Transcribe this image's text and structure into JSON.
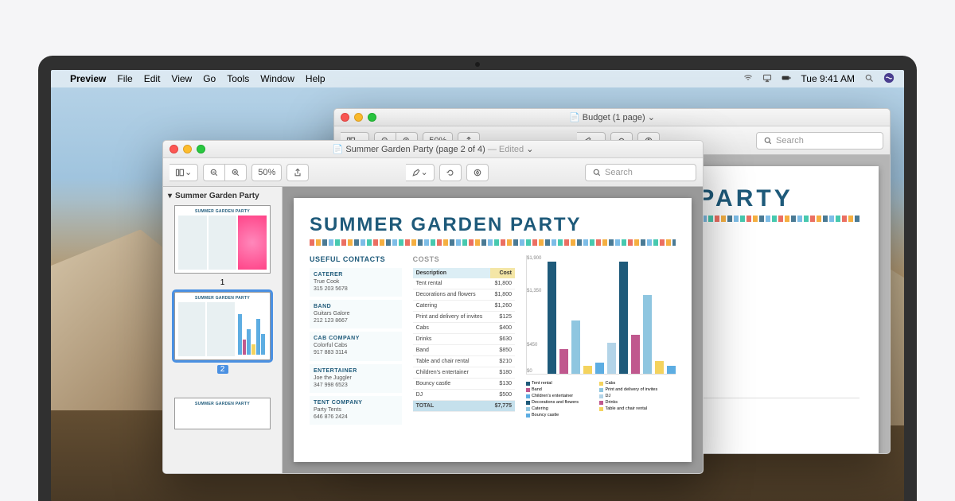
{
  "menubar": {
    "app": "Preview",
    "items": [
      "File",
      "Edit",
      "View",
      "Go",
      "Tools",
      "Window",
      "Help"
    ],
    "time": "Tue 9:41 AM"
  },
  "windows": {
    "back": {
      "title": "Budget (1 page)",
      "title_suffix": "",
      "zoom": "50%",
      "search_placeholder": "Search"
    },
    "front": {
      "title": "Summer Garden Party (page 2 of 4)",
      "title_suffix": "— Edited",
      "zoom": "50%",
      "search_placeholder": "Search",
      "sidebar_title": "Summer Garden Party",
      "thumb_labels": [
        "1",
        "2"
      ]
    }
  },
  "document": {
    "title": "SUMMER GARDEN PARTY",
    "contacts_heading": "USEFUL CONTACTS",
    "costs_heading": "COSTS",
    "contacts": [
      {
        "label": "CATERER",
        "name": "True Cook",
        "phone": "315 203 5678"
      },
      {
        "label": "BAND",
        "name": "Guitars Galore",
        "phone": "212 123 8667"
      },
      {
        "label": "CAB COMPANY",
        "name": "Colorful Cabs",
        "phone": "917 883 3114"
      },
      {
        "label": "ENTERTAINER",
        "name": "Joe the Juggler",
        "phone": "347 998 6523"
      },
      {
        "label": "TENT COMPANY",
        "name": "Party Tents",
        "phone": "646 876 2424"
      }
    ],
    "costs_cols": [
      "Description",
      "Cost"
    ],
    "costs": [
      {
        "d": "Tent rental",
        "c": "$1,800"
      },
      {
        "d": "Decorations and flowers",
        "c": "$1,800"
      },
      {
        "d": "Catering",
        "c": "$1,260"
      },
      {
        "d": "Print and delivery of invites",
        "c": "$125"
      },
      {
        "d": "Cabs",
        "c": "$400"
      },
      {
        "d": "Drinks",
        "c": "$630"
      },
      {
        "d": "Band",
        "c": "$850"
      },
      {
        "d": "Table and chair rental",
        "c": "$210"
      },
      {
        "d": "Children's entertainer",
        "c": "$180"
      },
      {
        "d": "Bouncy castle",
        "c": "$130"
      },
      {
        "d": "DJ",
        "c": "$500"
      }
    ],
    "total_label": "TOTAL",
    "total_value": "$7,775"
  },
  "chart_data": {
    "type": "bar",
    "title": "",
    "xlabel": "",
    "ylabel": "",
    "ylim": [
      0,
      1900
    ],
    "yticks": [
      "$1,900",
      "$1,350",
      "$450",
      "$0"
    ],
    "categories": [
      "Tent rental",
      "Cabs",
      "Band",
      "Print and delivery of invites",
      "Children's entertainer",
      "DJ",
      "Decorations and flowers",
      "Drinks",
      "Catering",
      "Table and chair rental",
      "Bouncy castle"
    ],
    "values": [
      1800,
      400,
      850,
      125,
      180,
      500,
      1800,
      630,
      1260,
      210,
      130
    ],
    "colors": [
      "#1e5a7a",
      "#c0588e",
      "#8fc6e0",
      "#f4d35e",
      "#5dade2",
      "#b3d4e8",
      "#1e5a7a",
      "#c0588e",
      "#8fc6e0",
      "#f4d35e",
      "#5dade2"
    ],
    "legend": [
      {
        "name": "Tent rental",
        "color": "#1e5a7a"
      },
      {
        "name": "Cabs",
        "color": "#f4d35e"
      },
      {
        "name": "Band",
        "color": "#c0588e"
      },
      {
        "name": "Print and delivery of invites",
        "color": "#8fc6e0"
      },
      {
        "name": "Children's entertainer",
        "color": "#5dade2"
      },
      {
        "name": "DJ",
        "color": "#b3d4e8"
      },
      {
        "name": "Decorations and flowers",
        "color": "#1e5a7a"
      },
      {
        "name": "Drinks",
        "color": "#c0588e"
      },
      {
        "name": "Catering",
        "color": "#8fc6e0"
      },
      {
        "name": "Table and chair rental",
        "color": "#f4d35e"
      },
      {
        "name": "Bouncy castle",
        "color": "#5dade2"
      }
    ]
  },
  "thumb_title": "SUMMER GARDEN PARTY"
}
